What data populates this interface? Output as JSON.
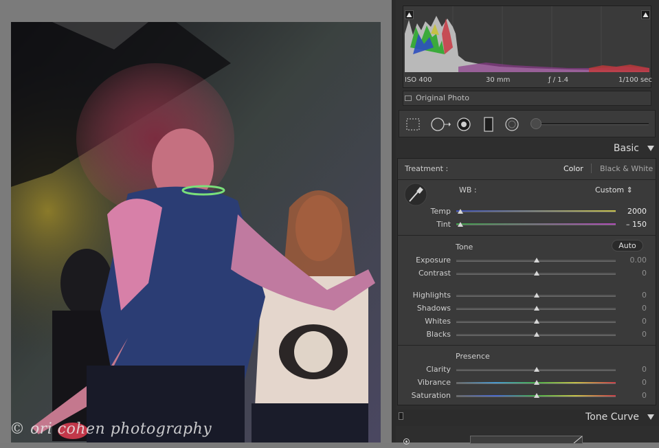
{
  "photo": {
    "watermark": "© ori cohen photography"
  },
  "histogram": {
    "iso": "ISO 400",
    "focal_length": "30 mm",
    "aperture": "ƒ / 1.4",
    "shutter": "1/100 sec"
  },
  "original_photo_label": "Original Photo",
  "tools": [
    "crop-overlay",
    "spot-removal",
    "red-eye-correction",
    "graduated-filter",
    "adjustment-brush"
  ],
  "basic": {
    "header": "Basic",
    "treatment_label": "Treatment :",
    "treatment_color": "Color",
    "treatment_bw": "Black & White",
    "wb_label": "WB :",
    "wb_value": "Custom",
    "temp": {
      "label": "Temp",
      "value": "2000",
      "level": 0
    },
    "tint": {
      "label": "Tint",
      "value": "– 150",
      "level": 0
    },
    "tone_label": "Tone",
    "auto_label": "Auto",
    "exposure": {
      "label": "Exposure",
      "value": "0.00",
      "level": 0.5
    },
    "contrast": {
      "label": "Contrast",
      "value": "0",
      "level": 0.5
    },
    "highlights": {
      "label": "Highlights",
      "value": "0",
      "level": 0.5
    },
    "shadows": {
      "label": "Shadows",
      "value": "0",
      "level": 0.5
    },
    "whites": {
      "label": "Whites",
      "value": "0",
      "level": 0.5
    },
    "blacks": {
      "label": "Blacks",
      "value": "0",
      "level": 0.5
    },
    "presence_label": "Presence",
    "clarity": {
      "label": "Clarity",
      "value": "0",
      "level": 0.5
    },
    "vibrance": {
      "label": "Vibrance",
      "value": "0",
      "level": 0.5
    },
    "saturation": {
      "label": "Saturation",
      "value": "0",
      "level": 0.5
    }
  },
  "tone_curve": {
    "header": "Tone Curve"
  },
  "colors": {
    "panel_bg": "#2e2e2e",
    "section_bg": "#3a3a3a",
    "canvas_bg": "#7b7b7b"
  }
}
